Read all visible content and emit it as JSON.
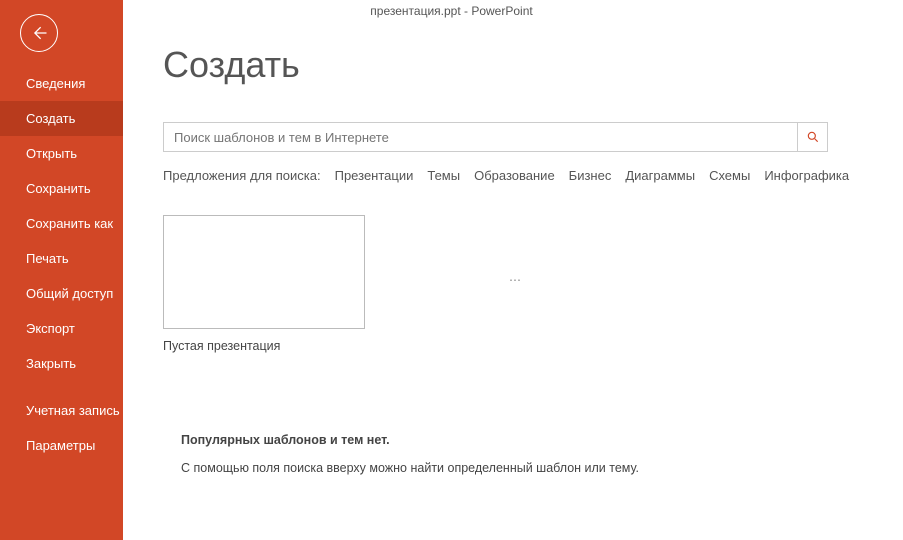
{
  "titleBar": "презентация.ppt - PowerPoint",
  "sidebar": {
    "items": [
      {
        "label": "Сведения",
        "selected": false
      },
      {
        "label": "Создать",
        "selected": true
      },
      {
        "label": "Открыть",
        "selected": false
      },
      {
        "label": "Сохранить",
        "selected": false
      },
      {
        "label": "Сохранить как",
        "selected": false
      },
      {
        "label": "Печать",
        "selected": false
      },
      {
        "label": "Общий доступ",
        "selected": false
      },
      {
        "label": "Экспорт",
        "selected": false
      },
      {
        "label": "Закрыть",
        "selected": false
      }
    ],
    "bottomItems": [
      {
        "label": "Учетная запись"
      },
      {
        "label": "Параметры"
      }
    ]
  },
  "page": {
    "title": "Создать",
    "search": {
      "placeholder": "Поиск шаблонов и тем в Интернете"
    },
    "suggestions": {
      "label": "Предложения для поиска:",
      "links": [
        "Презентации",
        "Темы",
        "Образование",
        "Бизнес",
        "Диаграммы",
        "Схемы",
        "Инфографика"
      ]
    },
    "templates": [
      {
        "label": "Пустая презентация"
      }
    ],
    "popular": {
      "title": "Популярных шаблонов и тем нет.",
      "text": "С помощью поля поиска вверху можно найти определенный шаблон или тему."
    }
  }
}
